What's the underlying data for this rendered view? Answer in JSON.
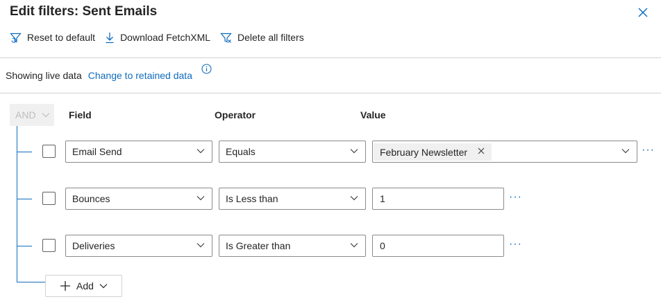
{
  "header": {
    "title": "Edit filters: Sent Emails"
  },
  "toolbar": {
    "reset_label": "Reset to default",
    "download_label": "Download FetchXML",
    "delete_label": "Delete all filters"
  },
  "data_mode": {
    "status_text": "Showing live data",
    "change_link": "Change to retained data"
  },
  "group": {
    "operator": "AND"
  },
  "columns": {
    "field": "Field",
    "operator": "Operator",
    "value": "Value"
  },
  "conditions": [
    {
      "field": "Email Send",
      "operator": "Equals",
      "value_tag": "February Newsletter"
    },
    {
      "field": "Bounces",
      "operator": "Is Less than",
      "value": "1"
    },
    {
      "field": "Deliveries",
      "operator": "Is Greater than",
      "value": "0"
    }
  ],
  "add_button": {
    "label": "Add"
  },
  "colors": {
    "accent": "#0f6cbd",
    "text": "#242424",
    "border": "#8a8a8a",
    "divider": "#d1d1d1"
  },
  "icons": [
    "filter-reset-icon",
    "download-icon",
    "filter-delete-icon",
    "close-icon",
    "info-icon",
    "chevron-down-icon",
    "plus-icon",
    "more-icon"
  ]
}
